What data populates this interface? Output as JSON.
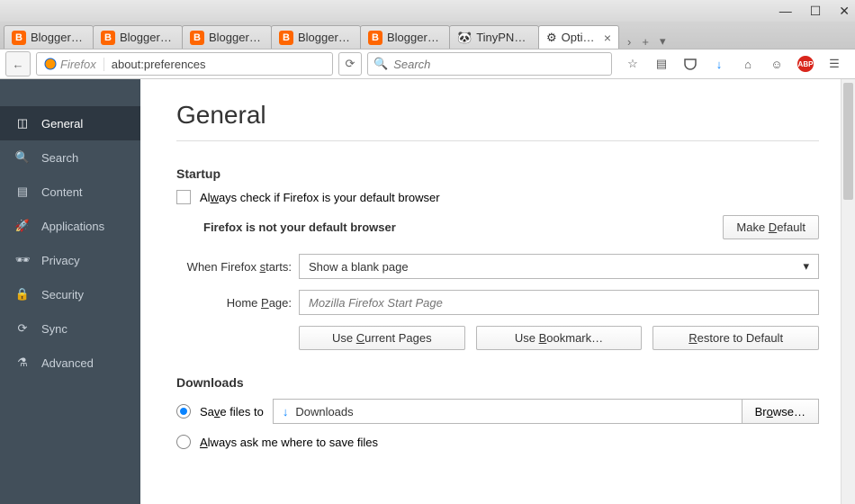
{
  "window": {
    "minimize": "—",
    "maximize": "☐",
    "close": "✕"
  },
  "tabs": [
    {
      "label": "Blogger: …",
      "type": "blogger"
    },
    {
      "label": "Blogger: …",
      "type": "blogger"
    },
    {
      "label": "Blogger: …",
      "type": "blogger"
    },
    {
      "label": "Blogger: …",
      "type": "blogger"
    },
    {
      "label": "Blogger: …",
      "type": "blogger"
    },
    {
      "label": "TinyPNG …",
      "type": "tinypng"
    },
    {
      "label": "Opti…",
      "type": "gear",
      "active": true
    }
  ],
  "tabactions": {
    "back": "›",
    "new": "+",
    "dropdown": "▾"
  },
  "nav": {
    "back": "←",
    "identity_label": "Firefox",
    "url": "about:preferences",
    "reload": "⟳",
    "search_placeholder": "Search"
  },
  "toolbar": {
    "star": "☆",
    "reader": "▤",
    "pocket": "⌄",
    "download": "↓",
    "home": "⌂",
    "hello": "☺",
    "abp": "ABP",
    "menu": "☰"
  },
  "sidebar": [
    {
      "label": "General",
      "icon": "◫",
      "active": true
    },
    {
      "label": "Search",
      "icon": "🔍"
    },
    {
      "label": "Content",
      "icon": "▤"
    },
    {
      "label": "Applications",
      "icon": "🚀"
    },
    {
      "label": "Privacy",
      "icon": "🕶"
    },
    {
      "label": "Security",
      "icon": "🔒"
    },
    {
      "label": "Sync",
      "icon": "⟳"
    },
    {
      "label": "Advanced",
      "icon": "⚗"
    }
  ],
  "page": {
    "title": "General",
    "startup": {
      "heading": "Startup",
      "always_check": "Always check if Firefox is your default browser",
      "status": "Firefox is not your default browser",
      "make_default": "Make Default",
      "when_starts_label": "When Firefox starts:",
      "when_starts_value": "Show a blank page",
      "home_page_label": "Home Page:",
      "home_page_placeholder": "Mozilla Firefox Start Page",
      "use_current": "Use Current Pages",
      "use_bookmark": "Use Bookmark…",
      "restore": "Restore to Default"
    },
    "downloads": {
      "heading": "Downloads",
      "save_to": "Save files to",
      "path": "Downloads",
      "browse": "Browse…",
      "always_ask": "Always ask me where to save files"
    }
  }
}
